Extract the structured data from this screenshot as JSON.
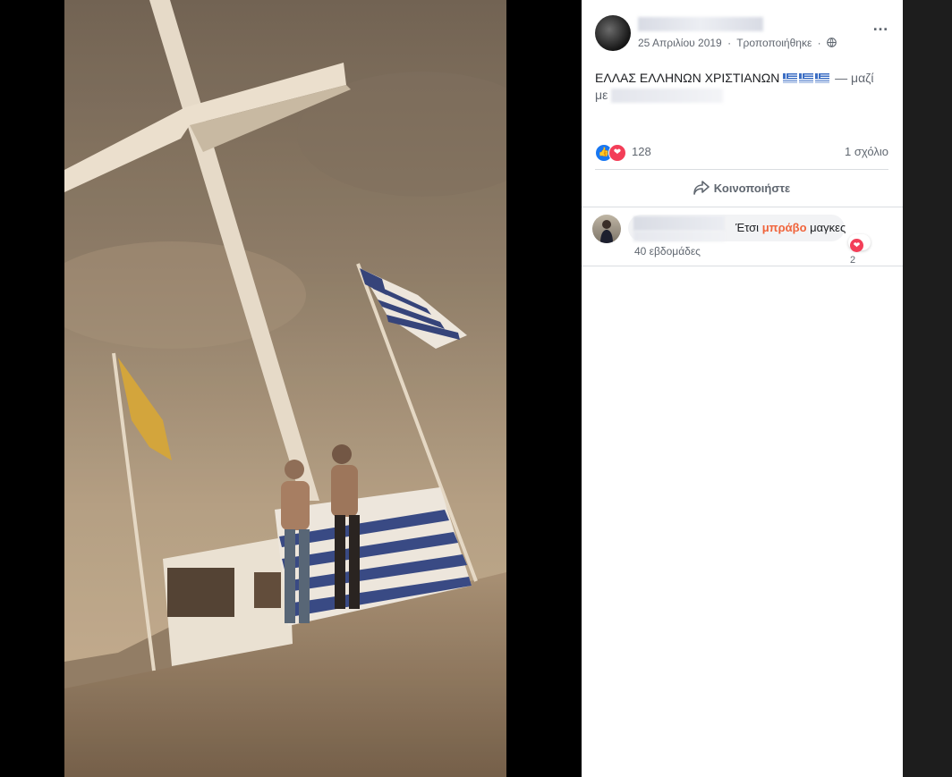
{
  "post": {
    "date": "25 Απριλίου 2019",
    "edited": "Τροποποιήθηκε",
    "dot": "·",
    "text": "ΕΛΛΑΣ ΕΛΛΗΝΩΝ ΧΡΙΣΤΙΑΝΩΝ",
    "with_sep": "— μαζί",
    "with_prefix": "με",
    "reaction_count": "128",
    "comment_count": "1 σχόλιο",
    "share_label": "Κοινοποιήστε"
  },
  "comment": {
    "text_pre": "Έτσι",
    "text_highlight": "μπράβο",
    "text_post": "μαγκες",
    "reaction_count": "2",
    "time": "40 εβδομάδες"
  },
  "icons": {
    "like": "thumbs-up-icon",
    "love": "heart-icon",
    "share": "share-arrow-icon",
    "globe": "globe-icon",
    "more": "more-options-icon"
  },
  "colors": {
    "link_highlight": "#f0643b",
    "like_blue": "#1877f2",
    "love_red": "#f33e58"
  }
}
